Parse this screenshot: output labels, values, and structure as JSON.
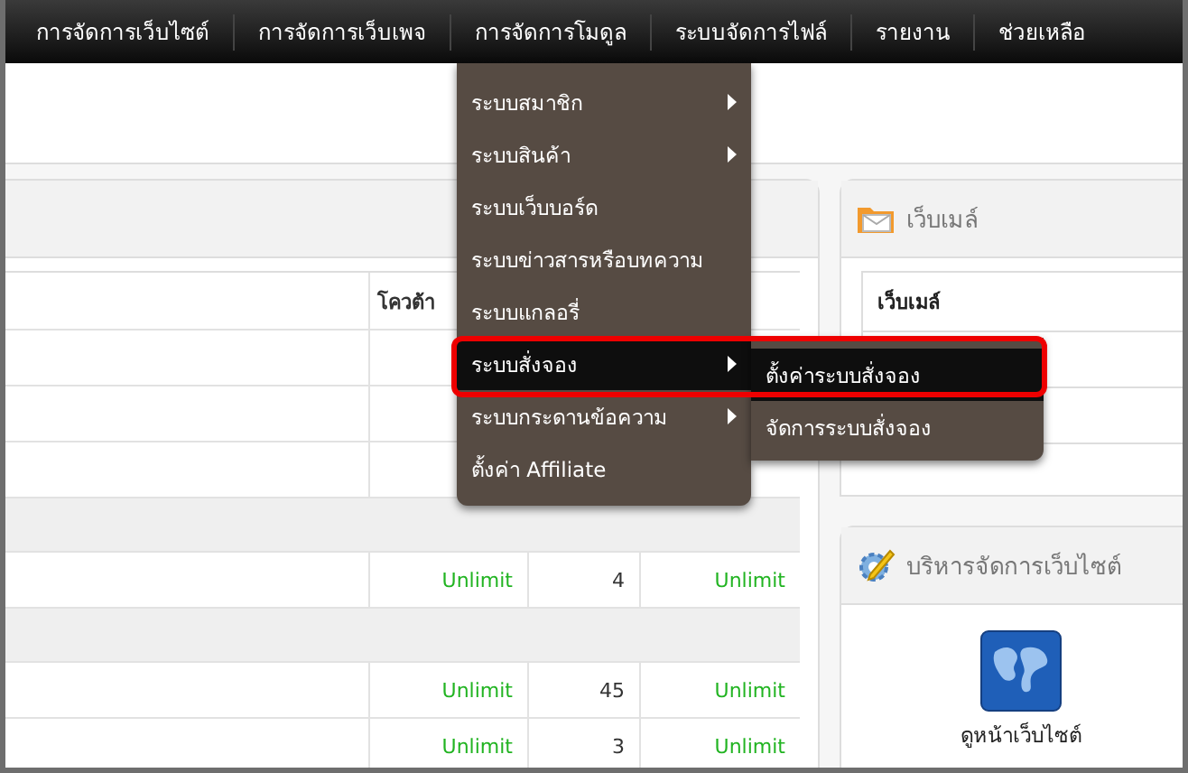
{
  "nav": {
    "items": [
      {
        "label": "การจัดการเว็บไซต์"
      },
      {
        "label": "การจัดการเว็บเพจ"
      },
      {
        "label": "การจัดการโมดูล"
      },
      {
        "label": "ระบบจัดการไฟล์"
      },
      {
        "label": "รายงาน"
      },
      {
        "label": "ช่วยเหลือ"
      }
    ]
  },
  "menu": {
    "items": [
      {
        "label": "ระบบสมาชิก",
        "has_submenu": true,
        "selected": false
      },
      {
        "label": "ระบบสินค้า",
        "has_submenu": true,
        "selected": false
      },
      {
        "label": "ระบบเว็บบอร์ด",
        "has_submenu": false,
        "selected": false
      },
      {
        "label": "ระบบข่าวสารหรือบทความ",
        "has_submenu": false,
        "selected": false
      },
      {
        "label": "ระบบแกลอรี่",
        "has_submenu": false,
        "selected": false
      },
      {
        "label": "ระบบสั่งจอง",
        "has_submenu": true,
        "selected": true
      },
      {
        "label": "ระบบกระดานข้อความ",
        "has_submenu": true,
        "selected": false
      },
      {
        "label": "ตั้งค่า Affiliate",
        "has_submenu": false,
        "selected": false
      }
    ],
    "submenu": {
      "items": [
        {
          "label": "ตั้งค่าระบบสั่งจอง",
          "selected": true
        },
        {
          "label": "จัดการระบบสั่งจอง",
          "selected": false
        }
      ]
    }
  },
  "quota_table": {
    "columns": [
      {
        "label": "โควต้า"
      }
    ],
    "rows": [
      {
        "kind": "data",
        "cells": []
      },
      {
        "kind": "data",
        "cells": []
      },
      {
        "kind": "data",
        "cells": []
      },
      {
        "kind": "group",
        "cells": []
      },
      {
        "kind": "data",
        "cells": [
          {
            "text": "Unlimit",
            "kind": "unlimited"
          },
          {
            "text": "4",
            "kind": "number"
          },
          {
            "text": "Unlimit",
            "kind": "unlimited"
          }
        ]
      },
      {
        "kind": "group",
        "cells": []
      },
      {
        "kind": "data",
        "cells": [
          {
            "text": "Unlimit",
            "kind": "unlimited"
          },
          {
            "text": "45",
            "kind": "number"
          },
          {
            "text": "Unlimit",
            "kind": "unlimited"
          }
        ]
      },
      {
        "kind": "data",
        "cells": [
          {
            "text": "Unlimit",
            "kind": "unlimited"
          },
          {
            "text": "3",
            "kind": "number"
          },
          {
            "text": "Unlimit",
            "kind": "unlimited"
          }
        ]
      }
    ]
  },
  "webmail_panel": {
    "title": "เว็บเมล์",
    "table_header": "เว็บเมล์"
  },
  "site_panel": {
    "title": "บริหารจัดการเว็บไซต์",
    "shortcut": {
      "label": "ดูหน้าเว็บไซต์"
    }
  }
}
